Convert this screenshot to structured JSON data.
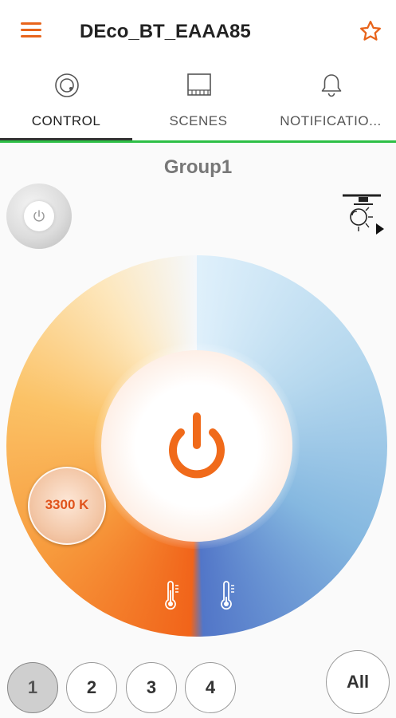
{
  "app": {
    "title": "DEco_BT_EAAA85",
    "accent_color": "#e8641b",
    "tab_divider_color": "#2ebf46"
  },
  "header": {
    "menu_icon": "hamburger-menu-icon",
    "favorite_icon": "star-outline-icon"
  },
  "tabs": [
    {
      "label": "CONTROL",
      "icon": "dial-icon",
      "active": true
    },
    {
      "label": "SCENES",
      "icon": "scenes-grid-icon",
      "active": false
    },
    {
      "label": "NOTIFICATIO...",
      "icon": "bell-icon",
      "active": false
    }
  ],
  "main": {
    "group_name": "Group1",
    "color_temperature": "3300 K",
    "warm_icon": "thermometer-warm-icon",
    "cold_icon": "thermometer-cold-icon",
    "power_icon": "power-icon",
    "ceiling_icon": "ceiling-light-icon"
  },
  "groups": {
    "buttons": [
      "1",
      "2",
      "3",
      "4"
    ],
    "selected": "1",
    "all_label": "All"
  }
}
